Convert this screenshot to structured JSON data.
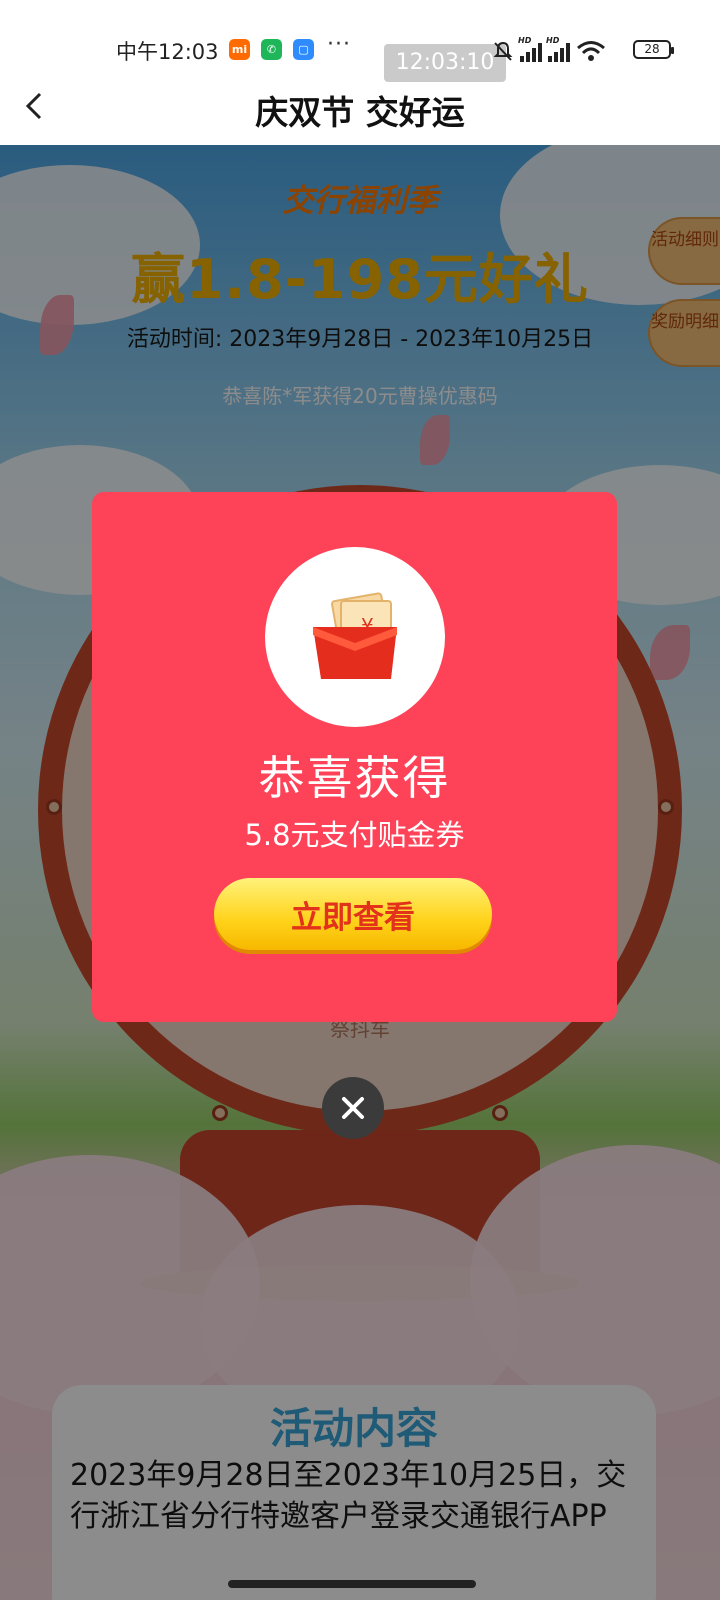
{
  "status_bar": {
    "time": "中午12:03",
    "screen_record_time": "12:03:10",
    "more": "···",
    "battery": "28",
    "signal_label": "HD"
  },
  "nav": {
    "title": "庆双节 交好运",
    "back_icon": "chevron-left-icon"
  },
  "page": {
    "brand_ribbon": "交行福利季",
    "headline": "赢1.8-198元好礼",
    "period": "活动时间: 2023年9月28日 - 2023年10月25日",
    "marquee": "恭喜陈*军获得20元曹操优惠码",
    "side_tabs": [
      {
        "label": "活动细则"
      },
      {
        "label": "奖励明细"
      }
    ],
    "wheel_caption": "祭抖车",
    "content": {
      "title": "活动内容",
      "body": "2023年9月28日至2023年10月25日，交行浙江省分行特邀客户登录交通银行APP"
    }
  },
  "modal": {
    "icon": "red-envelope-coupon-icon",
    "title": "恭喜获得",
    "subtitle": "5.8元支付贴金券",
    "cta_label": "立即查看",
    "close_icon": "close-icon",
    "colors": {
      "background": "#fe4358",
      "cta": "#ffd21a",
      "cta_text": "#e2321b"
    }
  }
}
